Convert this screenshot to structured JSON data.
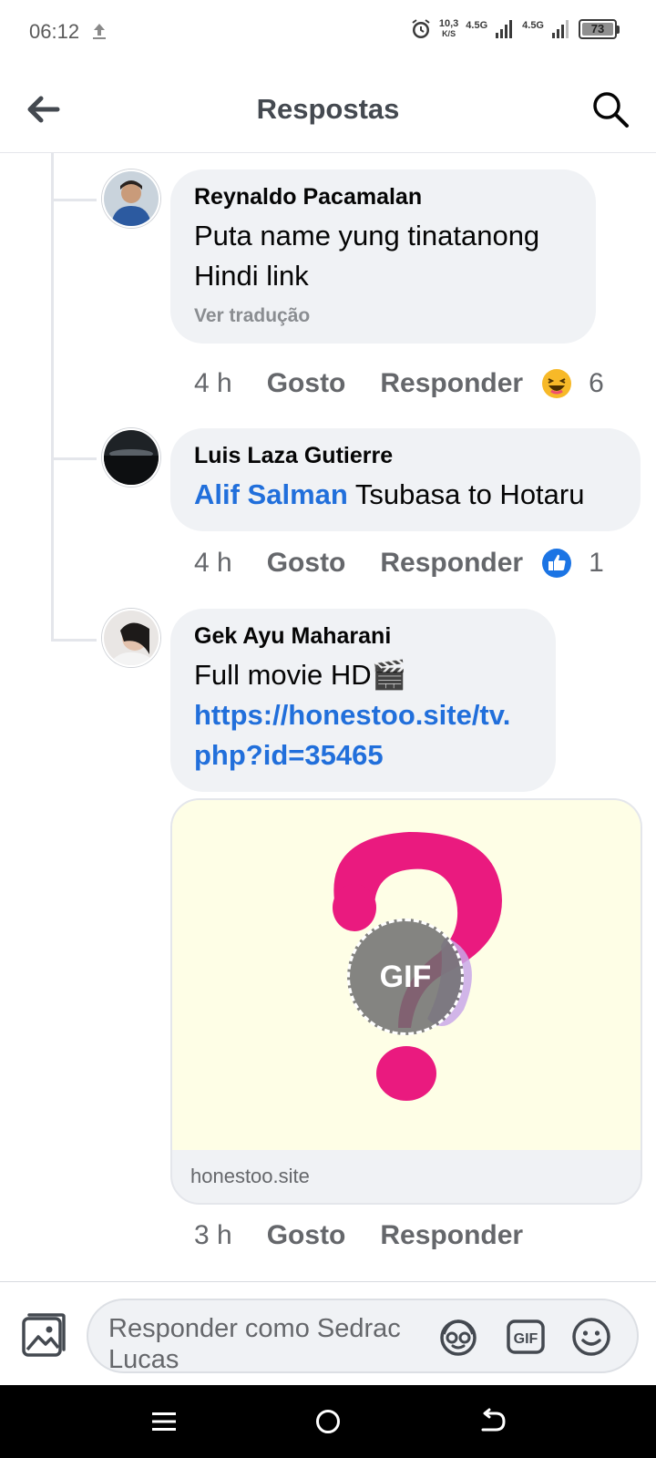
{
  "status_bar": {
    "time": "06:12",
    "net_speed_value": "10,3",
    "net_speed_unit": "K/S",
    "signal1_label": "4.5G",
    "signal2_label": "4.5G",
    "battery": "73"
  },
  "header": {
    "title": "Respostas"
  },
  "comments": [
    {
      "author": "Reynaldo Pacamalan",
      "text": "Puta name yung tinatanong Hindi link",
      "translate": "Ver tradução",
      "time": "4 h",
      "like": "Gosto",
      "reply": "Responder",
      "reaction_icon": "laughing-emoji-icon",
      "reaction_count": "6"
    },
    {
      "author": "Luis Laza Gutierre",
      "mention": "Alif Salman",
      "text": "Tsubasa to Hotaru",
      "time": "4 h",
      "like": "Gosto",
      "reply": "Responder",
      "reaction_icon": "like-thumb-icon",
      "reaction_count": "1"
    },
    {
      "author": "Gek Ayu Maharani",
      "text": "Full movie HD🎬",
      "link": "https://honestoo.site/tv.php?id=35465",
      "link_line1": "https://honestoo.site/tv.",
      "link_line2": "php?id=35465",
      "preview_badge": "GIF",
      "preview_domain": "honestoo.site",
      "time": "3 h",
      "like": "Gosto",
      "reply": "Responder"
    }
  ],
  "composer": {
    "placeholder": "Responder como Sedrac Lucas",
    "gif_label": "GIF"
  },
  "colors": {
    "accent": "#216fdb",
    "bubble": "#f0f2f5",
    "secondary_text": "#65676b"
  }
}
